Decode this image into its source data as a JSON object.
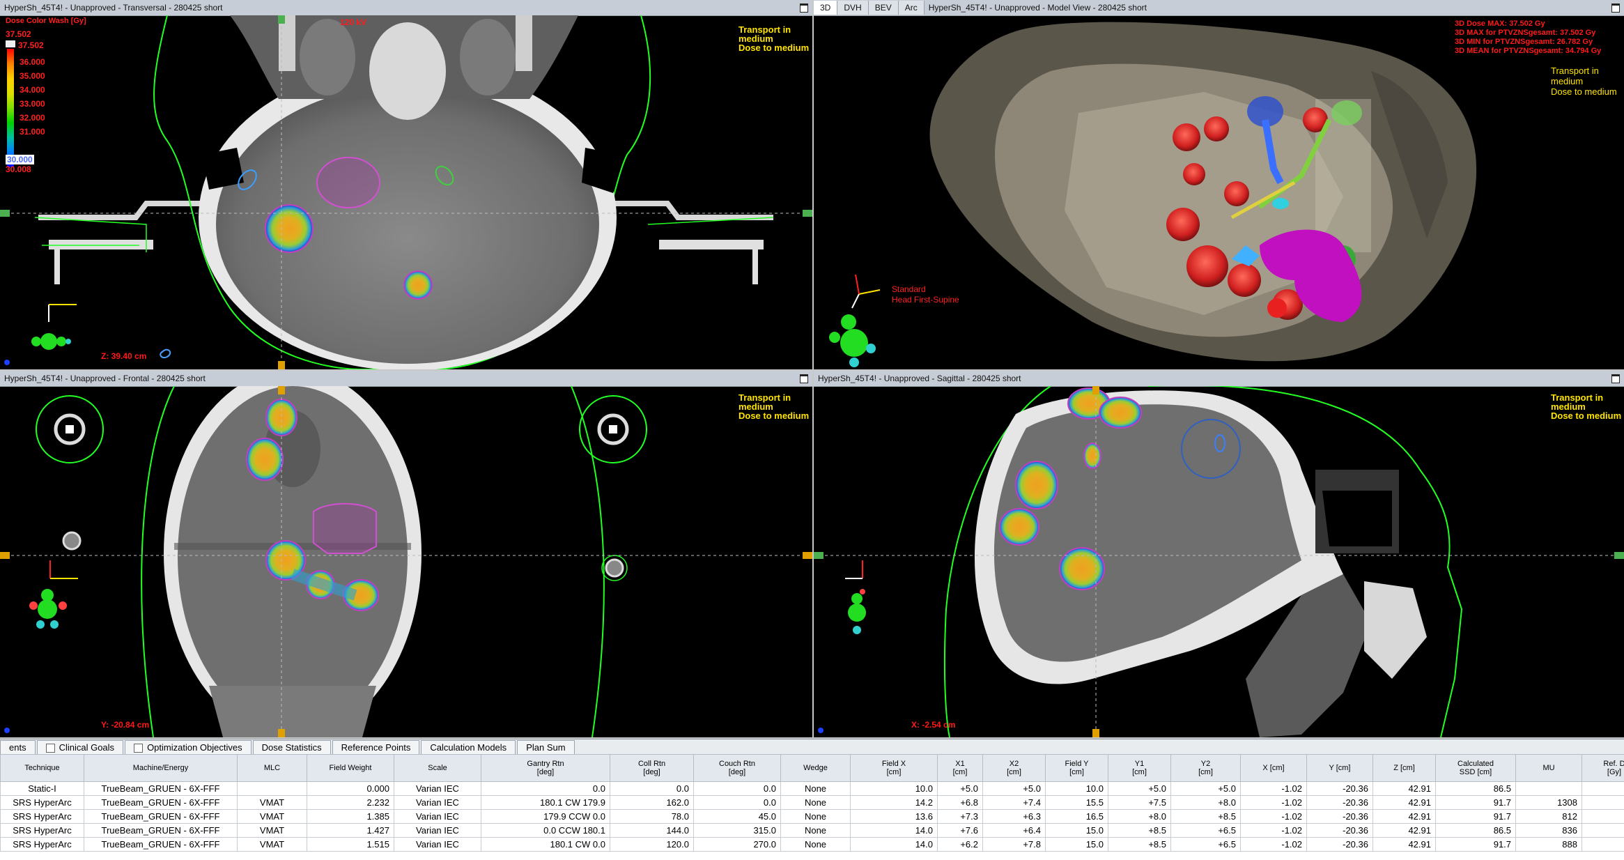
{
  "views": {
    "transversal": {
      "title": "HyperSh_45T4!  -  Unapproved - Transversal - 280425 short",
      "energy": "120 kV",
      "overlay": [
        "Transport in",
        "medium",
        "Dose to medium"
      ],
      "coord": "Z: 39.40 cm",
      "colorbar": {
        "title": "Dose Color Wash [Gy]",
        "top": "37.502",
        "max": "37.502",
        "ticks": [
          "36.000",
          "35.000",
          "34.000",
          "33.000",
          "32.000",
          "31.000"
        ],
        "low_handle": "30.000",
        "min": "30.008"
      }
    },
    "model": {
      "tabs": [
        "3D",
        "DVH",
        "BEV",
        "Arc"
      ],
      "title": "HyperSh_45T4!  -  Unapproved - Model View - 280425 short",
      "stats": [
        "3D Dose MAX: 37.502 Gy",
        "3D MAX for PTVZNSgesamt: 37.502 Gy",
        "3D MIN for PTVZNSgesamt: 26.782 Gy",
        "3D MEAN for PTVZNSgesamt: 34.794 Gy"
      ],
      "overlay": [
        "Transport in",
        "medium",
        "Dose to medium"
      ],
      "orientation": [
        "Standard",
        "Head First-Supine"
      ]
    },
    "frontal": {
      "title": "HyperSh_45T4!  -  Unapproved - Frontal - 280425 short",
      "overlay": [
        "Transport in",
        "medium",
        "Dose to medium"
      ],
      "coord": "Y: -20.84 cm"
    },
    "sagittal": {
      "title": "HyperSh_45T4!  -  Unapproved - Sagittal - 280425 short",
      "overlay": [
        "Transport in",
        "medium",
        "Dose to medium"
      ],
      "coord": "X: -2.54 cm"
    }
  },
  "bottom_tabs": [
    {
      "label": "ents",
      "check": false
    },
    {
      "label": "Clinical Goals",
      "check": true
    },
    {
      "label": "Optimization Objectives",
      "check": true
    },
    {
      "label": "Dose Statistics",
      "check": false
    },
    {
      "label": "Reference Points",
      "check": false
    },
    {
      "label": "Calculation Models",
      "check": false
    },
    {
      "label": "Plan Sum",
      "check": false
    }
  ],
  "table": {
    "columns": [
      "Technique",
      "Machine/Energy",
      "MLC",
      "Field Weight",
      "Scale",
      "Gantry Rtn\n[deg]",
      "Coll Rtn\n[deg]",
      "Couch Rtn\n[deg]",
      "Wedge",
      "Field X\n[cm]",
      "X1\n[cm]",
      "X2\n[cm]",
      "Field Y\n[cm]",
      "Y1\n[cm]",
      "Y2\n[cm]",
      "X [cm]",
      "Y [cm]",
      "Z [cm]",
      "Calculated\nSSD [cm]",
      "MU",
      "Ref. D\n[Gy]"
    ],
    "rows": [
      [
        "Static-I",
        "TrueBeam_GRUEN - 6X-FFF",
        "",
        "0.000",
        "Varian IEC",
        "0.0",
        "0.0",
        "0.0",
        "None",
        "10.0",
        "+5.0",
        "+5.0",
        "10.0",
        "+5.0",
        "+5.0",
        "-1.02",
        "-20.36",
        "42.91",
        "86.5",
        "",
        ""
      ],
      [
        "SRS HyperArc",
        "TrueBeam_GRUEN - 6X-FFF",
        "VMAT",
        "2.232",
        "Varian IEC",
        "180.1 CW 179.9",
        "162.0",
        "0.0",
        "None",
        "14.2",
        "+6.8",
        "+7.4",
        "15.5",
        "+7.5",
        "+8.0",
        "-1.02",
        "-20.36",
        "42.91",
        "91.7",
        "1308",
        ""
      ],
      [
        "SRS HyperArc",
        "TrueBeam_GRUEN - 6X-FFF",
        "VMAT",
        "1.385",
        "Varian IEC",
        "179.9 CCW 0.0",
        "78.0",
        "45.0",
        "None",
        "13.6",
        "+7.3",
        "+6.3",
        "16.5",
        "+8.0",
        "+8.5",
        "-1.02",
        "-20.36",
        "42.91",
        "91.7",
        "812",
        ""
      ],
      [
        "SRS HyperArc",
        "TrueBeam_GRUEN - 6X-FFF",
        "VMAT",
        "1.427",
        "Varian IEC",
        "0.0 CCW 180.1",
        "144.0",
        "315.0",
        "None",
        "14.0",
        "+7.6",
        "+6.4",
        "15.0",
        "+8.5",
        "+6.5",
        "-1.02",
        "-20.36",
        "42.91",
        "86.5",
        "836",
        ""
      ],
      [
        "SRS HyperArc",
        "TrueBeam_GRUEN - 6X-FFF",
        "VMAT",
        "1.515",
        "Varian IEC",
        "180.1 CW 0.0",
        "120.0",
        "270.0",
        "None",
        "14.0",
        "+6.2",
        "+7.8",
        "15.0",
        "+8.5",
        "+6.5",
        "-1.02",
        "-20.36",
        "42.91",
        "91.7",
        "888",
        ""
      ]
    ]
  },
  "colors": {
    "contour_body": "#22ff22",
    "overlay_text": "#ffe400",
    "stat_text": "#ff1a1a",
    "view_header": "#c7cdd6",
    "ptv": "#c040c0"
  }
}
